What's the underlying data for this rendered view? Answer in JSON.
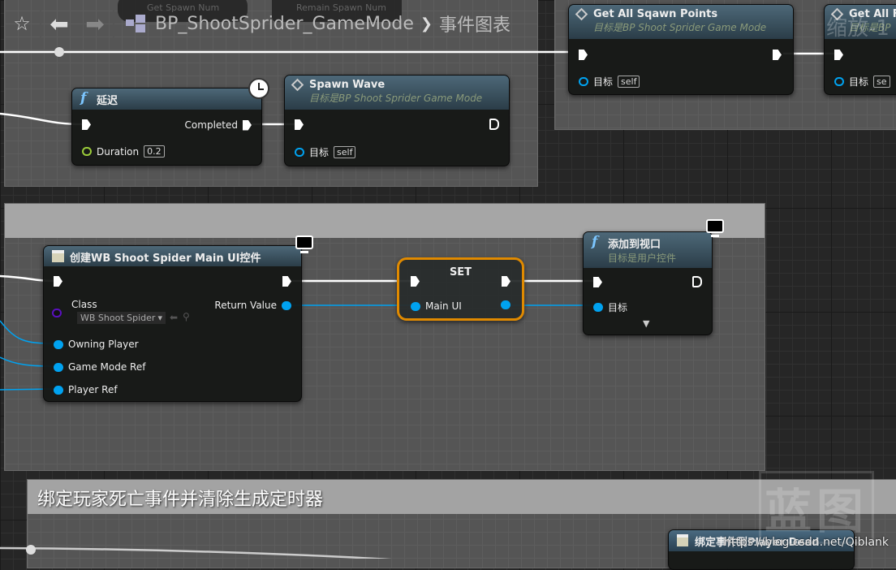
{
  "toolbar": {
    "favorite_icon": "star-icon",
    "back_icon": "arrow-left-icon",
    "forward_icon": "arrow-right-icon",
    "blueprint_name": "BP_ShootSprider_GameMode",
    "separator": "❯",
    "graph_name": "事件图表",
    "ghost_nodes": [
      "Get Spawn Num",
      "Remain Spawn Num"
    ]
  },
  "zoom_label": "缩放-1",
  "nodes": {
    "delay": {
      "title": "延迟",
      "completed": "Completed",
      "duration_label": "Duration",
      "duration_value": "0.2"
    },
    "spawn_wave": {
      "title": "Spawn Wave",
      "subtitle": "目标是BP Shoot Sprider Game Mode",
      "target_label": "目标",
      "target_value": "self"
    },
    "get_spawn_points": {
      "title": "Get All Sqawn Points",
      "subtitle": "目标是BP Shoot Sprider Game Mode",
      "target_label": "目标",
      "target_value": "self"
    },
    "get_spawn_points_2": {
      "title": "Get All F",
      "subtitle": "目标是BP",
      "target_label": "目标",
      "target_value": "se"
    },
    "create_widget": {
      "title": "创建WB Shoot Spider Main UI控件",
      "class_label": "Class",
      "class_value": "WB Shoot Spider",
      "return_label": "Return Value",
      "owning_player": "Owning Player",
      "game_mode_ref": "Game Mode Ref",
      "player_ref": "Player Ref"
    },
    "set": {
      "title": "SET",
      "var": "Main UI"
    },
    "add_to_viewport": {
      "title": "添加到视口",
      "subtitle": "目标是用户控件",
      "target_label": "目标"
    },
    "bind_event": {
      "title": "绑定事件到Player Dead"
    }
  },
  "comments": {
    "bottom": "绑定玩家死亡事件并清除生成定时器"
  },
  "watermark": {
    "logo": "蓝图",
    "url": "https://blog.csdn.net/Qiblank"
  },
  "colors": {
    "exec": "#ffffff",
    "object_pin": "#00a2f0",
    "class_pin": "#5a10c0",
    "float_pin": "#9bcc3a",
    "set_border": "#e08a00"
  }
}
